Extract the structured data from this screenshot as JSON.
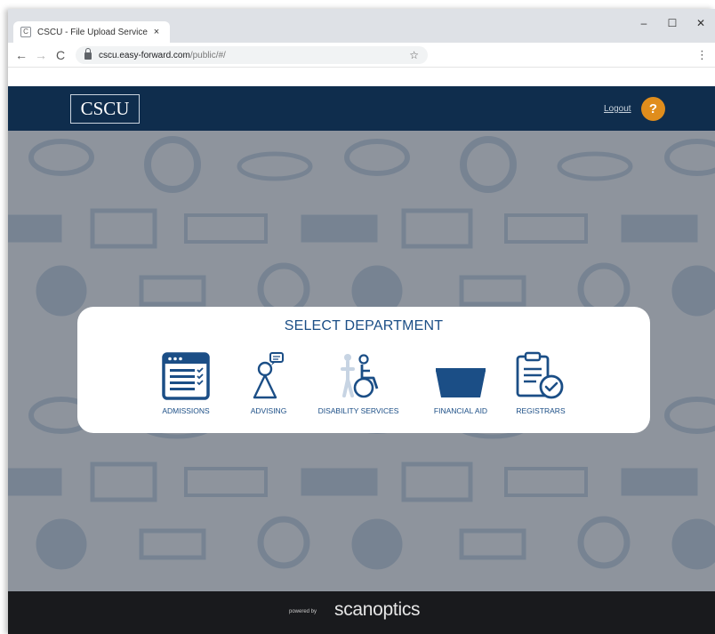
{
  "browser": {
    "tab_title": "CSCU - File Upload Service",
    "tab_favicon": "C",
    "tab_close": "×",
    "url_host": "cscu.easy-forward.com",
    "url_path": "/public/#/",
    "window_controls": {
      "minimize": "–",
      "maximize": "☐",
      "close": "✕"
    },
    "nav": {
      "back": "←",
      "forward": "→",
      "reload": "C"
    },
    "star": "☆",
    "menu": "⋮"
  },
  "header": {
    "logo": "CSCU",
    "logout_label": "Logout",
    "help_label": "?"
  },
  "modal": {
    "title": "SELECT DEPARTMENT",
    "departments": [
      {
        "label": "ADMISSIONS",
        "icon": "admissions-form-icon"
      },
      {
        "label": "ADVISING",
        "icon": "advisor-chat-icon"
      },
      {
        "label": "DISABILITY SERVICES",
        "icon": "wheelchair-icon"
      },
      {
        "label": "FINANCIAL AID",
        "icon": "financial-aid-icon"
      },
      {
        "label": "REGISTRARS",
        "icon": "clipboard-check-icon"
      }
    ]
  },
  "footer": {
    "powered_by": "powered by",
    "brand": "scanoptics"
  },
  "colors": {
    "header_bg": "#0f2d4d",
    "accent_orange": "#e08d1c",
    "icon_blue": "#1b4e86",
    "footer_bg": "#191a1d"
  }
}
